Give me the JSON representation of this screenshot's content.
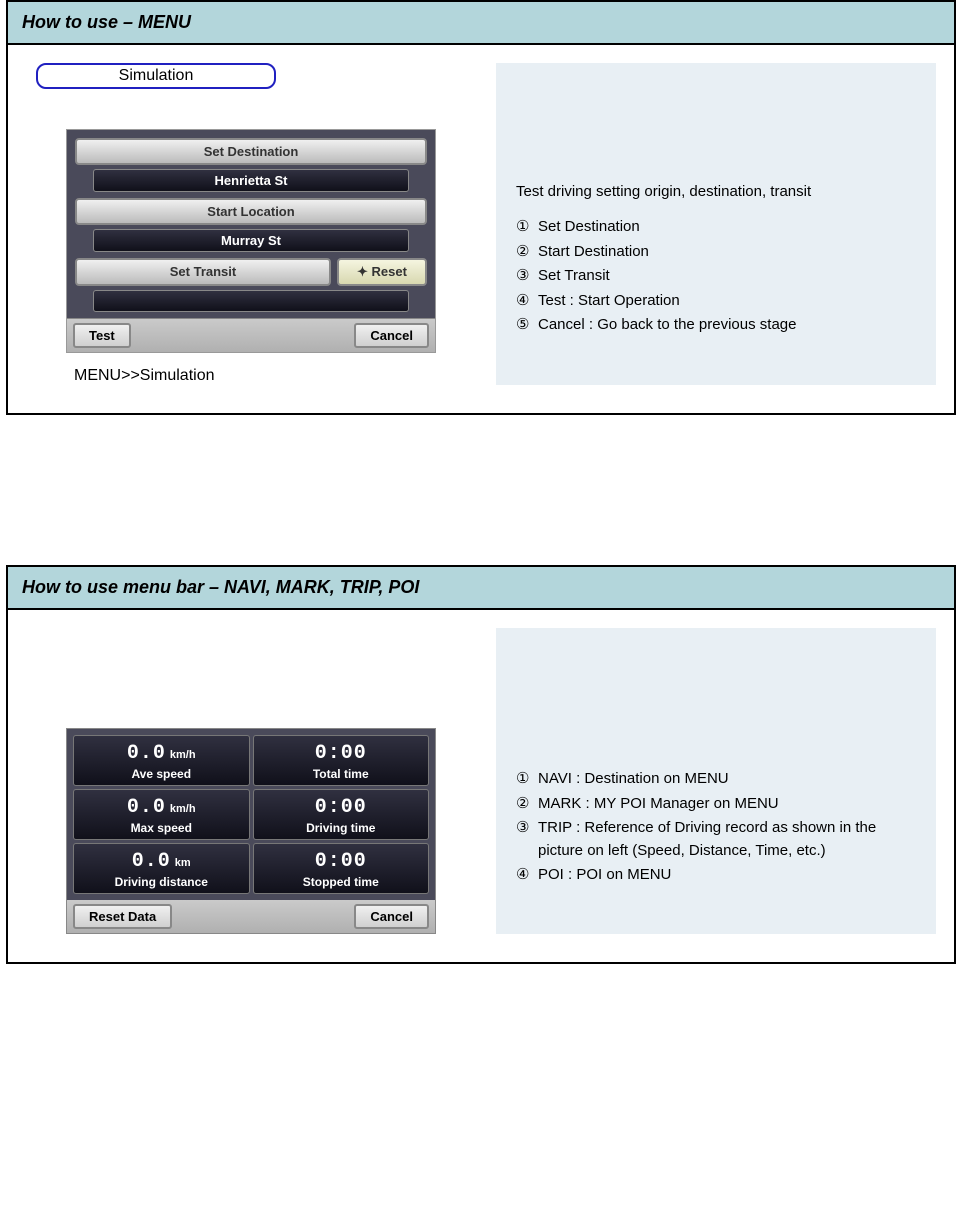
{
  "section1": {
    "title": "How to use – MENU",
    "chip": "Simulation",
    "device": {
      "set_destination": "Set Destination",
      "dest_val": "Henrietta St",
      "start_location": "Start Location",
      "start_val": "Murray St",
      "set_transit": "Set Transit",
      "reset": "✦ Reset",
      "transit_val": "",
      "test": "Test",
      "cancel": "Cancel"
    },
    "caption": "MENU>>Simulation",
    "desc": "Test driving setting origin, destination, transit",
    "items": [
      "Set Destination",
      "Start Destination",
      "Set Transit",
      "Test : Start Operation",
      "Cancel : Go back to the previous stage"
    ]
  },
  "section2": {
    "title": "How to use menu bar – NAVI, MARK, TRIP, POI",
    "trip": {
      "cells": [
        {
          "val": "0.0",
          "unit": "km/h",
          "label": "Ave speed"
        },
        {
          "val": "0:00",
          "unit": "",
          "label": "Total time"
        },
        {
          "val": "0.0",
          "unit": "km/h",
          "label": "Max speed"
        },
        {
          "val": "0:00",
          "unit": "",
          "label": "Driving time"
        },
        {
          "val": "0.0",
          "unit": "km",
          "label": "Driving distance"
        },
        {
          "val": "0:00",
          "unit": "",
          "label": "Stopped time"
        }
      ],
      "reset_data": "Reset Data",
      "cancel": "Cancel"
    },
    "items": [
      "NAVI : Destination on MENU",
      "MARK : MY POI Manager on MENU",
      "TRIP : Reference of Driving record as shown in the picture on left (Speed, Distance, Time, etc.)",
      "POI : POI on MENU"
    ]
  },
  "marks": [
    "①",
    "②",
    "③",
    "④",
    "⑤"
  ]
}
